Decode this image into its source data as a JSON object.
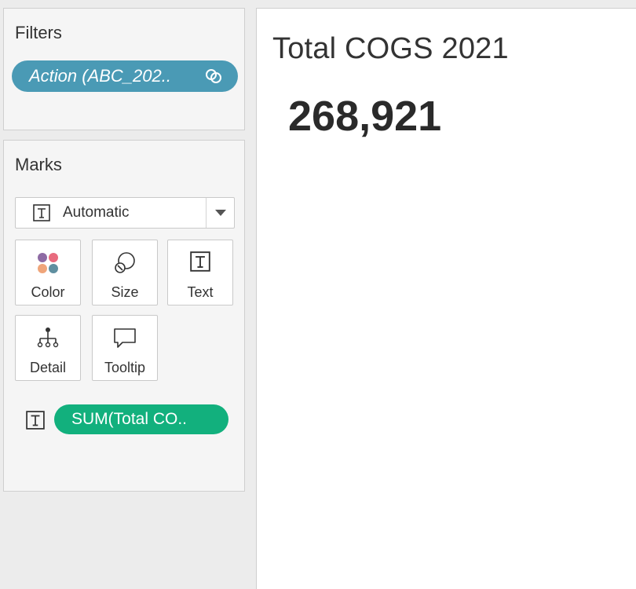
{
  "filters": {
    "title": "Filters",
    "pill": {
      "label": "Action (ABC_202..",
      "color": "#4a9ab5",
      "icon": "link-icon"
    }
  },
  "marks": {
    "title": "Marks",
    "mark_type": {
      "label": "Automatic",
      "icon": "text-t-icon"
    },
    "cards": [
      {
        "label": "Color",
        "icon": "color-dots-icon"
      },
      {
        "label": "Size",
        "icon": "size-icon"
      },
      {
        "label": "Text",
        "icon": "text-t-icon"
      },
      {
        "label": "Detail",
        "icon": "detail-hierarchy-icon"
      },
      {
        "label": "Tooltip",
        "icon": "tooltip-speech-icon"
      }
    ],
    "field": {
      "label": "SUM(Total CO..",
      "color": "#12b07d",
      "icon": "text-t-icon"
    }
  },
  "viz": {
    "title": "Total COGS 2021",
    "value": "268,921"
  }
}
